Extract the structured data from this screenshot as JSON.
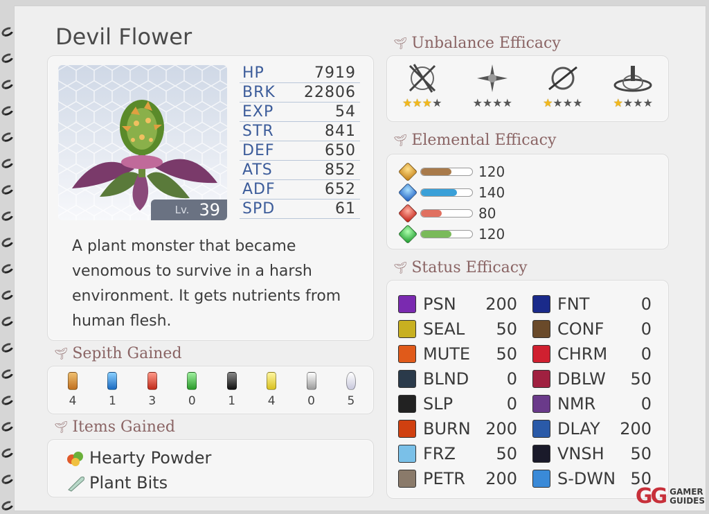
{
  "monster": {
    "name": "Devil Flower",
    "level_label": "Lv.",
    "level": "39",
    "description": "A plant monster that became venomous to survive in a harsh environment. It gets nutrients from human flesh."
  },
  "stats": [
    {
      "key": "HP",
      "value": "7919"
    },
    {
      "key": "BRK",
      "value": "22806"
    },
    {
      "key": "EXP",
      "value": "54"
    },
    {
      "key": "STR",
      "value": "841"
    },
    {
      "key": "DEF",
      "value": "650"
    },
    {
      "key": "ATS",
      "value": "852"
    },
    {
      "key": "ADF",
      "value": "652"
    },
    {
      "key": "SPD",
      "value": "61"
    }
  ],
  "sections": {
    "sepith": "Sepith Gained",
    "items": "Items Gained",
    "unbalance": "Unbalance Efficacy",
    "elemental": "Elemental Efficacy",
    "status": "Status Efficacy"
  },
  "sepith": [
    {
      "icon": "earth-sepith-icon",
      "color": "#d9902a",
      "value": "4"
    },
    {
      "icon": "water-sepith-icon",
      "color": "#2f8fe0",
      "value": "1"
    },
    {
      "icon": "fire-sepith-icon",
      "color": "#e04a3a",
      "value": "3"
    },
    {
      "icon": "wind-sepith-icon",
      "color": "#47c04a",
      "value": "0"
    },
    {
      "icon": "time-sepith-icon",
      "color": "#333333",
      "value": "1"
    },
    {
      "icon": "space-sepith-icon",
      "color": "#f2dc3a",
      "value": "4"
    },
    {
      "icon": "mirage-sepith-icon",
      "color": "#c8c8c8",
      "value": "0"
    },
    {
      "icon": "mass-sepith-icon",
      "color": "#e6e6f0",
      "value": "5"
    }
  ],
  "items": [
    {
      "icon": "hearty-powder-icon",
      "name": "Hearty Powder"
    },
    {
      "icon": "plant-bits-icon",
      "name": "Plant Bits"
    }
  ],
  "unbalance": [
    {
      "icon": "slash-icon",
      "stars": 3
    },
    {
      "icon": "thrust-icon",
      "stars": 0
    },
    {
      "icon": "pierce-icon",
      "stars": 1
    },
    {
      "icon": "strike-icon",
      "stars": 1
    }
  ],
  "elemental": [
    {
      "icon": "earth-element-icon",
      "color": "#d9902a",
      "bar_color": "#a87a4a",
      "value": "120",
      "fill": 0.6
    },
    {
      "icon": "water-element-icon",
      "color": "#2f8fe0",
      "bar_color": "#3aa0d8",
      "value": "140",
      "fill": 0.7
    },
    {
      "icon": "fire-element-icon",
      "color": "#e04a3a",
      "bar_color": "#e07060",
      "value": "80",
      "fill": 0.4
    },
    {
      "icon": "wind-element-icon",
      "color": "#47c04a",
      "bar_color": "#7aba5a",
      "value": "120",
      "fill": 0.6
    }
  ],
  "status_left": [
    {
      "icon": "poison-icon",
      "icon_color": "#7a2ab0",
      "name": "PSN",
      "value": "200"
    },
    {
      "icon": "seal-icon",
      "icon_color": "#c8b020",
      "name": "SEAL",
      "value": "50"
    },
    {
      "icon": "mute-icon",
      "icon_color": "#e05a1a",
      "name": "MUTE",
      "value": "50"
    },
    {
      "icon": "blind-icon",
      "icon_color": "#2a3a4a",
      "name": "BLND",
      "value": "0"
    },
    {
      "icon": "sleep-icon",
      "icon_color": "#222222",
      "name": "SLP",
      "value": "0"
    },
    {
      "icon": "burn-icon",
      "icon_color": "#d04010",
      "name": "BURN",
      "value": "200"
    },
    {
      "icon": "freeze-icon",
      "icon_color": "#7ac0e8",
      "name": "FRZ",
      "value": "50"
    },
    {
      "icon": "petrify-icon",
      "icon_color": "#8a7a6a",
      "name": "PETR",
      "value": "200"
    }
  ],
  "status_right": [
    {
      "icon": "faint-icon",
      "icon_color": "#1a2a8a",
      "name": "FNT",
      "value": "0"
    },
    {
      "icon": "confuse-icon",
      "icon_color": "#6a4a2a",
      "name": "CONF",
      "value": "0"
    },
    {
      "icon": "charm-icon",
      "icon_color": "#d02030",
      "name": "CHRM",
      "value": "0"
    },
    {
      "icon": "deathblow-icon",
      "icon_color": "#a02040",
      "name": "DBLW",
      "value": "50"
    },
    {
      "icon": "nightmare-icon",
      "icon_color": "#6a3a8a",
      "name": "NMR",
      "value": "0"
    },
    {
      "icon": "delay-icon",
      "icon_color": "#2a5aa8",
      "name": "DLAY",
      "value": "200"
    },
    {
      "icon": "vanish-icon",
      "icon_color": "#1a1a2a",
      "name": "VNSH",
      "value": "50"
    },
    {
      "icon": "stat-down-icon",
      "icon_color": "#3a8ad8",
      "name": "S-DWN",
      "value": "50"
    }
  ],
  "watermark": {
    "mark": "GG",
    "line1": "GAMER",
    "line2": "GUIDES"
  }
}
